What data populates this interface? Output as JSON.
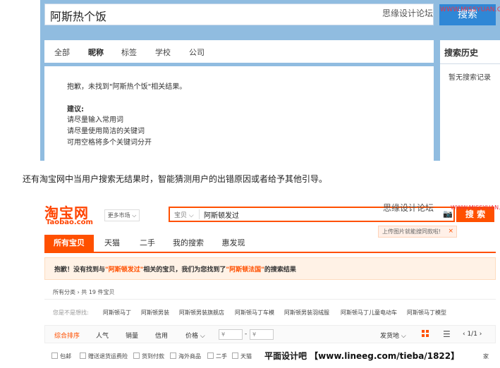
{
  "top": {
    "search_query": "阿斯热个饭",
    "watermark": "思缘设计论坛",
    "search_button": "搜索",
    "button_watermark": "WWW.MISSYUAN.COM",
    "tabs": [
      "全部",
      "昵称",
      "标签",
      "学校",
      "公司"
    ],
    "active_tab": "昵称",
    "panel": {
      "sorry": "抱歉，未找到\"阿斯热个饭\"相关结果。",
      "advice_title": "建议:",
      "advice": [
        "请尽量输入常用词",
        "请尽量使用简洁的关键词",
        "可用空格将多个关键词分开"
      ]
    },
    "history": {
      "title": "搜索历史",
      "empty": "暂无搜索记录"
    }
  },
  "caption": "还有淘宝网中当用户搜索无结果时，智能猜测用户的出错原因或者给予其他引导。",
  "taobao": {
    "logo_cn": "淘宝网",
    "logo_en": "Taobao.com",
    "more_market": "更多市场 ⌵",
    "category": "宝贝 ⌵",
    "query": "阿斯顿发过",
    "watermark": "思缘设计论坛",
    "search_button": "搜 索",
    "button_watermark": "WWW.MISSYUAN.COM",
    "image_tip": "上传图片就能搜同款啦!",
    "image_tip_close": "×",
    "nav_tabs": [
      "所有宝贝",
      "天猫",
      "二手",
      "我的搜索",
      "惠发现"
    ],
    "notice": {
      "prefix": "抱歉！没有找到与",
      "wrong": "\"阿斯顿发过\"",
      "middle": "相关的宝贝，我们为您找到了",
      "guess": "\"阿斯顿法国\"",
      "suffix": "的搜索结果"
    },
    "breadcrumb": "所有分类 › 共 19 件宝贝",
    "suggest_label": "您是不是想找:",
    "suggestions": [
      "阿斯顿马丁",
      "阿斯顿男装",
      "阿斯顿男装旗舰店",
      "阿斯顿马丁车模",
      "阿斯顿男装羽绒服",
      "阿斯顿马丁儿童电动车",
      "阿斯顿马丁模型"
    ],
    "sort": {
      "items": [
        "综合排序",
        "人气",
        "销量",
        "信用",
        "价格 ⌵"
      ],
      "price_from": "¥",
      "price_sep": "-",
      "price_to": "¥",
      "ship_from": "发货地 ⌵",
      "list_icon": "☰",
      "pager": "‹  1/1  ›"
    },
    "filters": [
      "包邮",
      "赠送退货运费险",
      "货到付款",
      "海外商品",
      "二手",
      "天猫"
    ],
    "filter_tail": "家",
    "bottom_watermark": "平面设计吧 【www.lineeg.com/tieba/1822】"
  }
}
